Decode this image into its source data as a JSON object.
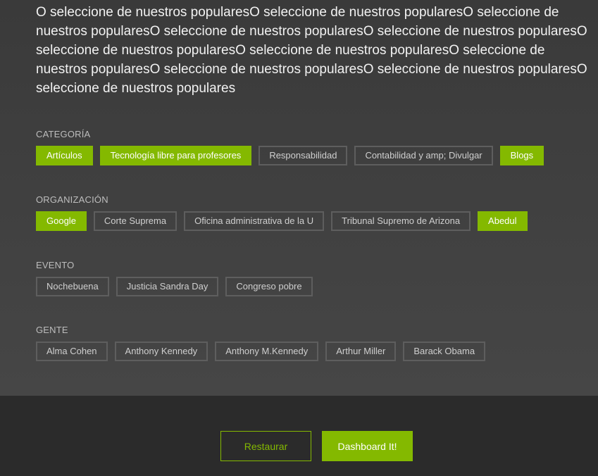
{
  "intro_text": "O seleccione de nuestros popularesO seleccione de nuestros popularesO seleccione de nuestros popularesO seleccione de nuestros popularesO seleccione de nuestros popularesO seleccione de nuestros popularesO seleccione de nuestros popularesO seleccione de nuestros popularesO seleccione de nuestros popularesO seleccione de nuestros popularesO seleccione de nuestros populares",
  "groups": {
    "categoria": {
      "label": "CATEGORÍA",
      "tags": [
        {
          "label": "Artículos",
          "selected": true
        },
        {
          "label": "Tecnología libre para profesores",
          "selected": true
        },
        {
          "label": "Responsabilidad",
          "selected": false
        },
        {
          "label": "Contabilidad y amp; Divulgar",
          "selected": false
        },
        {
          "label": "Blogs",
          "selected": true
        }
      ]
    },
    "organizacion": {
      "label": "ORGANIZACIÓN",
      "tags": [
        {
          "label": "Google",
          "selected": true
        },
        {
          "label": "Corte Suprema",
          "selected": false
        },
        {
          "label": "Oficina administrativa de la U",
          "selected": false
        },
        {
          "label": "Tribunal Supremo de Arizona",
          "selected": false
        },
        {
          "label": "Abedul",
          "selected": true
        }
      ]
    },
    "evento": {
      "label": "EVENTO",
      "tags": [
        {
          "label": "Nochebuena",
          "selected": false
        },
        {
          "label": "Justicia Sandra Day",
          "selected": false
        },
        {
          "label": "Congreso pobre",
          "selected": false
        }
      ]
    },
    "gente": {
      "label": "GENTE",
      "tags": [
        {
          "label": "Alma Cohen",
          "selected": false
        },
        {
          "label": "Anthony Kennedy",
          "selected": false
        },
        {
          "label": "Anthony M.Kennedy",
          "selected": false
        },
        {
          "label": "Arthur Miller",
          "selected": false
        },
        {
          "label": "Barack Obama",
          "selected": false
        }
      ]
    }
  },
  "footer": {
    "reset_label": "Restaurar",
    "submit_label": "Dashboard It!"
  },
  "colors": {
    "accent": "#84b900",
    "panel_bg": "#3f3f3f",
    "footer_bg": "#2b2b2b",
    "tag_border": "#5e5e5e"
  }
}
